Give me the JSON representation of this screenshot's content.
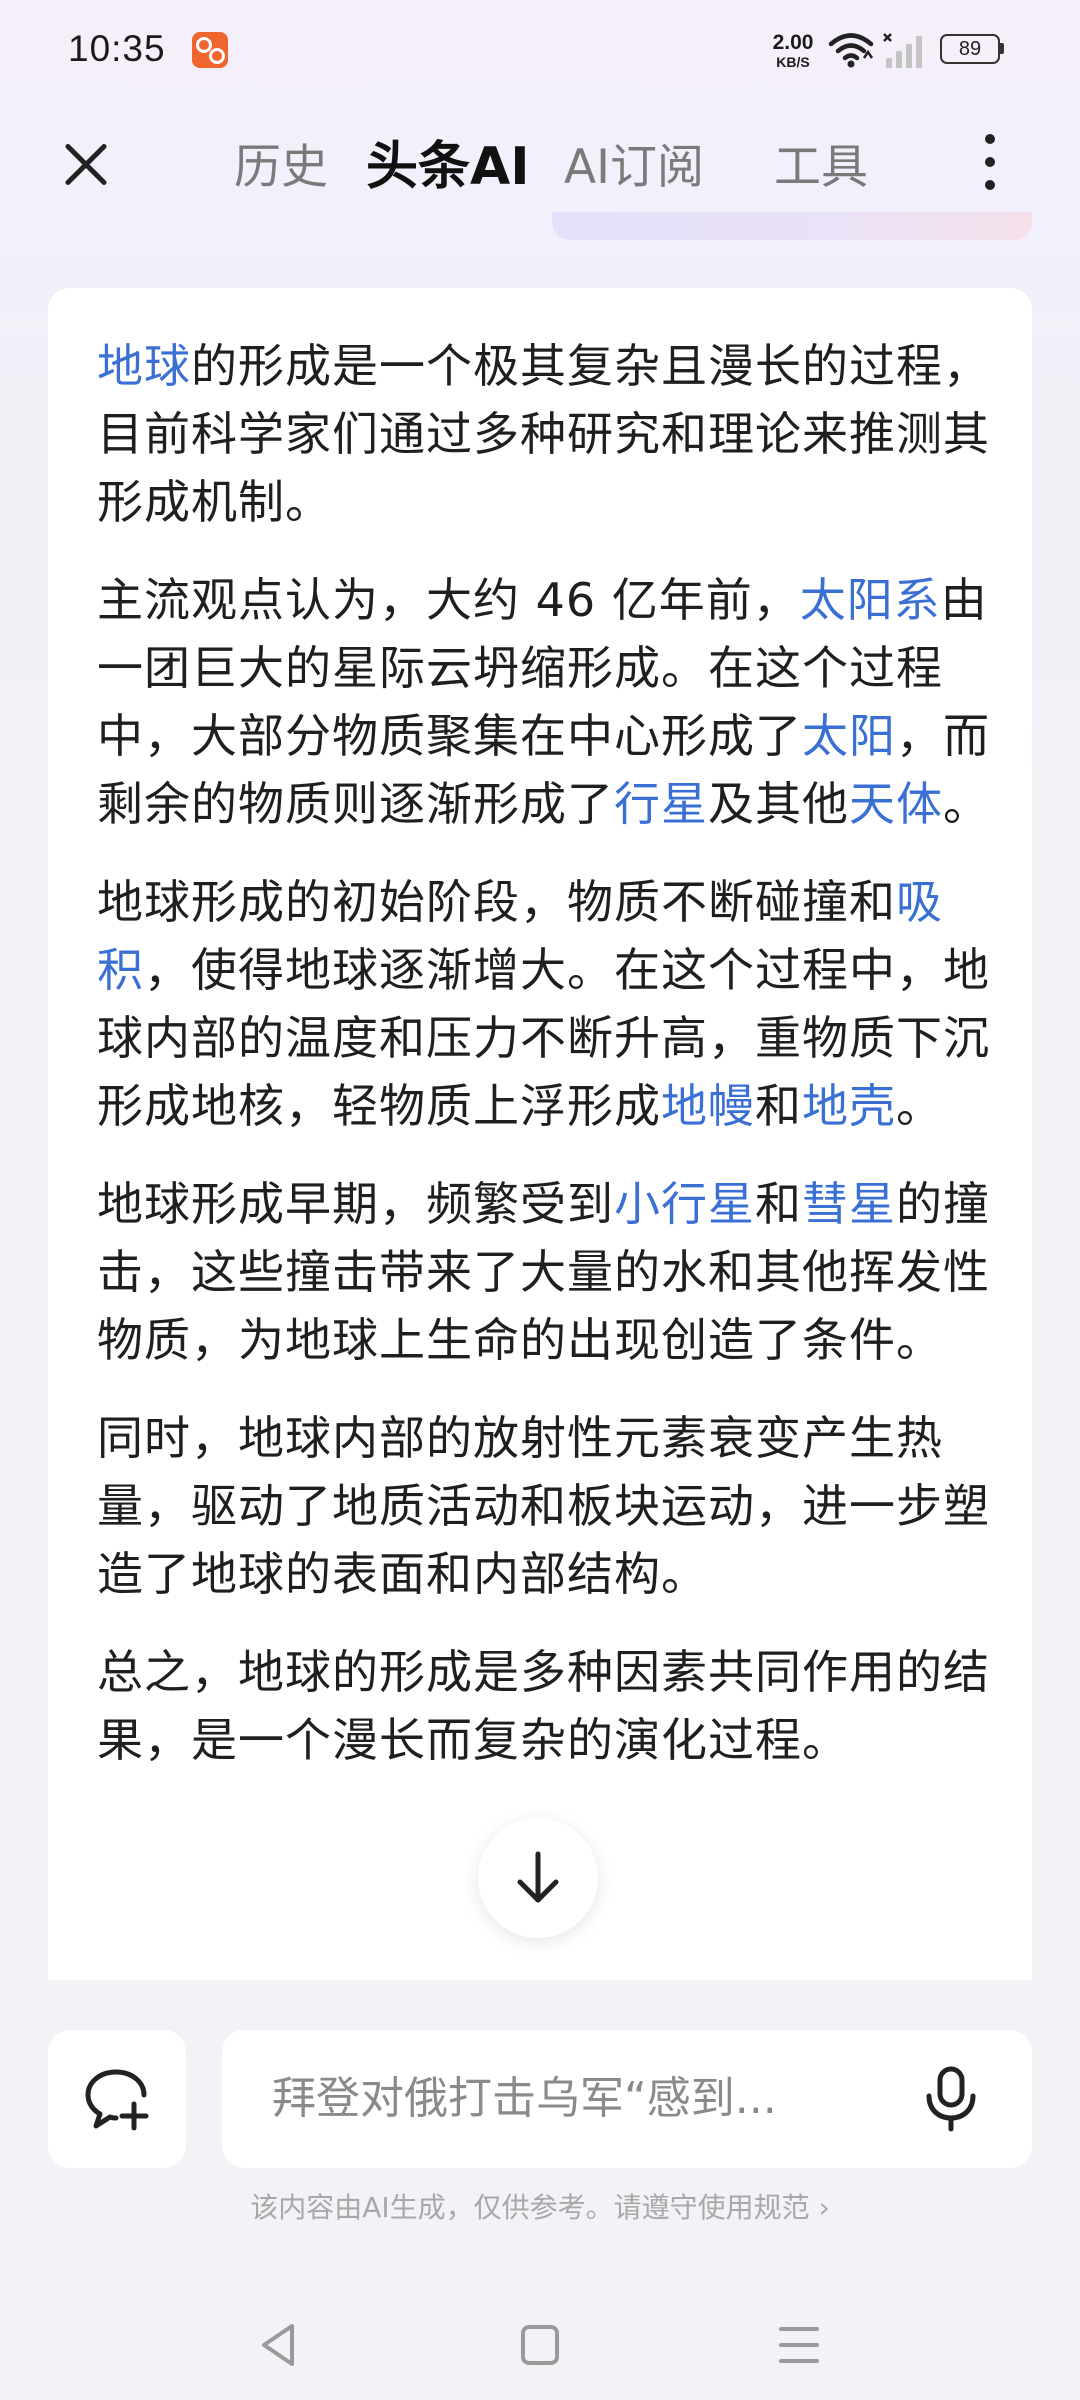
{
  "status_bar": {
    "time": "10:35",
    "net_speed_value": "2.00",
    "net_speed_unit": "KB/S",
    "battery": "89",
    "icons": [
      "app-notification-icon",
      "wifi-icon",
      "signal-icon",
      "battery-icon"
    ]
  },
  "nav": {
    "tabs": [
      {
        "label": "历史",
        "active": false
      },
      {
        "label": "头条AI",
        "active": true
      },
      {
        "label": "AI订阅",
        "active": false
      },
      {
        "label": "工具",
        "active": false
      }
    ],
    "icons": [
      "close-icon",
      "more-vertical-icon"
    ]
  },
  "answer": {
    "p1": {
      "k1": "地球",
      "t1": "的形成是一个极其复杂且漫长的过程，目前科学家们通过多种研究和理论来推测其形成机制。"
    },
    "p2": {
      "t1": "主流观点认为，大约 46 亿年前，",
      "k1": "太阳系",
      "t2": "由一团巨大的星际云坍缩形成。在这个过程中，大部分物质聚集在中心形成了",
      "k2": "太阳",
      "t3": "，而剩余的物质则逐渐形成了",
      "k3": "行星",
      "t4": "及其他",
      "k4": "天体",
      "t5": "。"
    },
    "p3": {
      "t1": "地球形成的初始阶段，物质不断碰撞和",
      "k1": "吸积",
      "t2": "，使得地球逐渐增大。在这个过程中，地球内部的温度和压力不断升高，重物质下沉形成地核，轻物质上浮形成",
      "k2": "地幔",
      "t3": "和",
      "k3": "地壳",
      "t4": "。"
    },
    "p4": {
      "t1": "地球形成早期，频繁受到",
      "k1": "小行星",
      "t2": "和",
      "k2": "彗星",
      "t3": "的撞击，这些撞击带来了大量的水和其他挥发性物质，为地球上生命的出现创造了条件。"
    },
    "p5": {
      "t1": "同时，地球内部的放射性元素衰变产生热量，驱动了地质活动和板块运动，进一步塑造了地球的表面和内部结构。"
    },
    "p6": {
      "t1": "总之，地球的形成是多种因素共同作用的结果，是一个漫长而复杂的演化过程。"
    },
    "link_color": "#3a6fd4",
    "scroll_icon": "arrow-down-icon"
  },
  "input": {
    "placeholder": "拜登对俄打击乌军“感到...",
    "icons": [
      "new-chat-icon",
      "microphone-icon"
    ]
  },
  "disclaimer": {
    "text": "该内容由AI生成，仅供参考。请遵守",
    "link": "使用规范",
    "arrow": "›"
  },
  "system_nav": {
    "icons": [
      "back-triangle-icon",
      "home-square-icon",
      "menu-lines-icon"
    ]
  }
}
